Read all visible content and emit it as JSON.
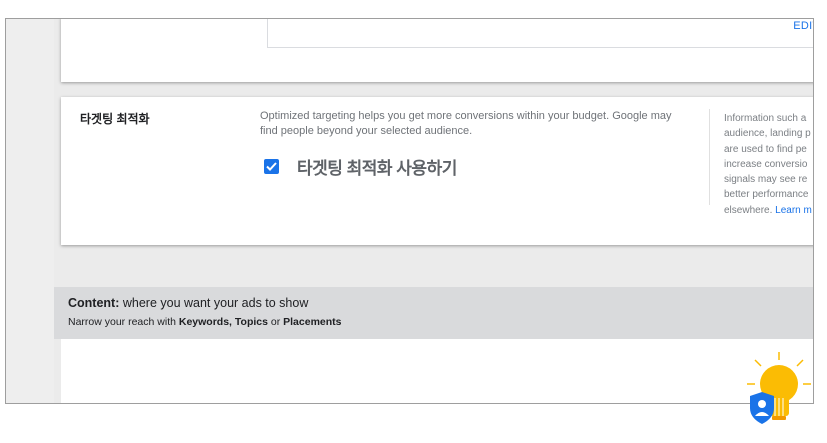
{
  "top_card": {
    "edit_label": "EDIT /"
  },
  "targeting": {
    "title": "타겟팅 최적화",
    "description": "Optimized targeting helps you get more conversions within your budget. Google may find people beyond your selected audience.",
    "checkbox_checked": true,
    "checkbox_label": "타겟팅 최적화 사용하기",
    "info_lines": [
      "Information such a",
      "audience, landing p",
      "are used to find pe",
      "increase conversio",
      "signals may see re",
      "better performance",
      "elsewhere."
    ],
    "info_link": "Learn m"
  },
  "content_section": {
    "title_bold": "Content:",
    "title_rest": " where you want your ads to show",
    "subtitle_prefix": "Narrow your reach with ",
    "keywords": "Keywords,",
    "topics": "Topics",
    "or": " or ",
    "placements": "Placements"
  },
  "colors": {
    "accent": "#1a73e8",
    "bulb": "#fbbc04",
    "shield": "#1a73e8"
  }
}
